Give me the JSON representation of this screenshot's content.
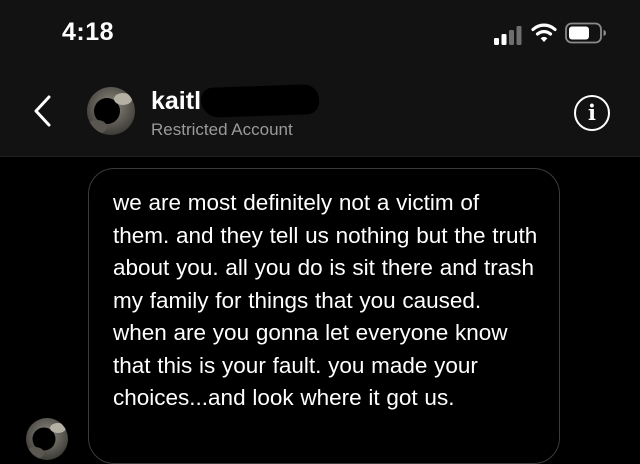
{
  "status_bar": {
    "time": "4:18",
    "signal_icon": "cellular-signal-icon",
    "wifi_icon": "wifi-icon",
    "battery_icon": "battery-icon"
  },
  "header": {
    "back_icon": "chevron-left-icon",
    "contact_name": "kaitl",
    "contact_status": "Restricted Account",
    "info_icon": "info-icon",
    "info_glyph": "i"
  },
  "conversation": {
    "messages": [
      {
        "text": "we are most definitely not a victim of them. and they tell us nothing but the truth about you. all you do is sit there and trash my family for things that you caused. when are you gonna let everyone know that this is your fault. you made your choices...and look where it got us."
      }
    ]
  },
  "colors": {
    "background": "#000000",
    "header_background": "#121212",
    "text_primary": "#ffffff",
    "text_secondary": "#9a9a9a",
    "bubble_border": "#3a3a3a"
  }
}
